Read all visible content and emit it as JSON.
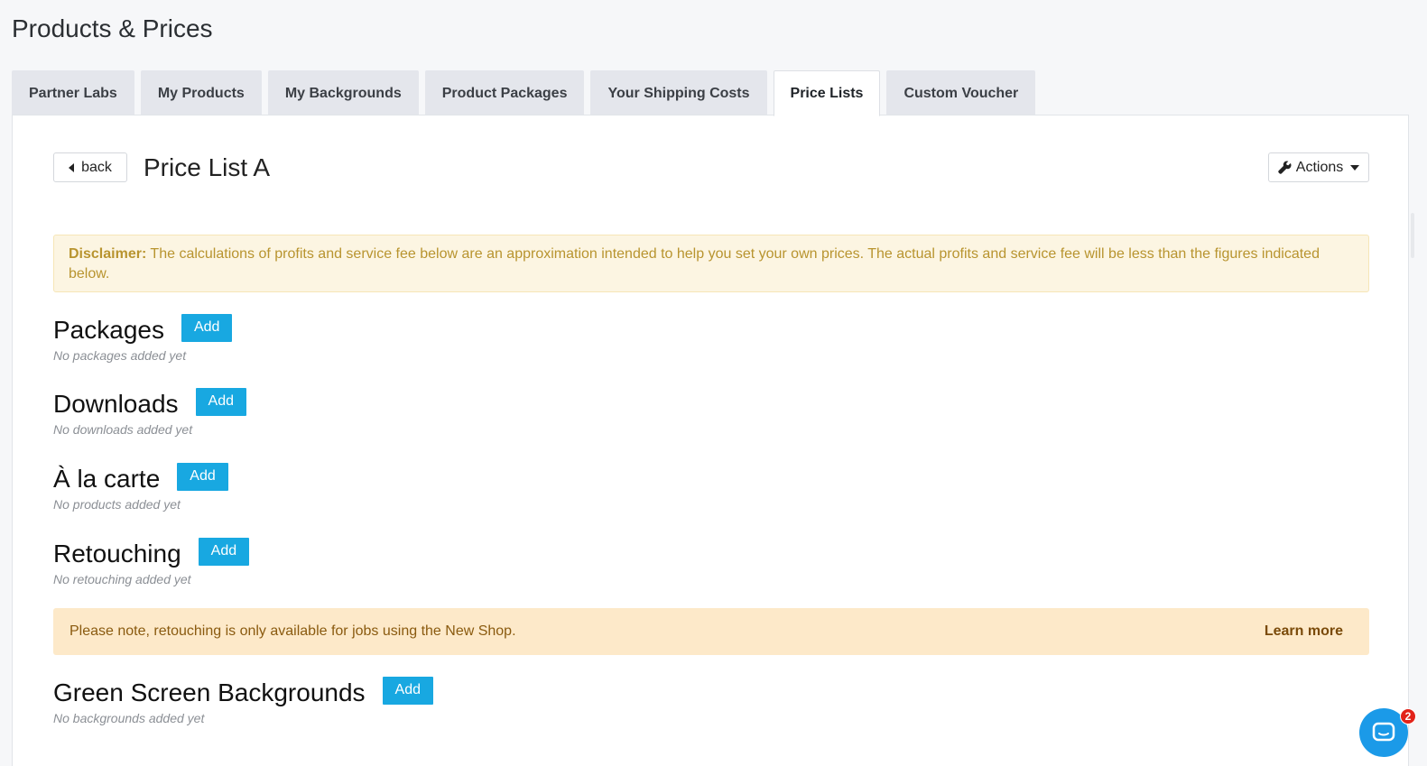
{
  "page": {
    "title": "Products & Prices"
  },
  "tabs": [
    {
      "label": "Partner Labs",
      "active": false
    },
    {
      "label": "My Products",
      "active": false
    },
    {
      "label": "My Backgrounds",
      "active": false
    },
    {
      "label": "Product Packages",
      "active": false
    },
    {
      "label": "Your Shipping Costs",
      "active": false
    },
    {
      "label": "Price Lists",
      "active": true
    },
    {
      "label": "Custom Voucher",
      "active": false
    }
  ],
  "header": {
    "back_label": "back",
    "list_title": "Price List A",
    "actions_label": "Actions"
  },
  "disclaimer": {
    "label": "Disclaimer:",
    "text": " The calculations of profits and service fee below are an approximation intended to help you set your own prices. The actual profits and service fee will be less than the figures indicated below."
  },
  "sections": {
    "packages": {
      "title": "Packages",
      "add_label": "Add",
      "empty": "No packages added yet"
    },
    "downloads": {
      "title": "Downloads",
      "add_label": "Add",
      "empty": "No downloads added yet"
    },
    "alacarte": {
      "title": "À la carte",
      "add_label": "Add",
      "empty": "No products added yet"
    },
    "retouching": {
      "title": "Retouching",
      "add_label": "Add",
      "empty": "No retouching added yet"
    },
    "backgrounds": {
      "title": "Green Screen Backgrounds",
      "add_label": "Add",
      "empty": "No backgrounds added yet"
    }
  },
  "retouch_note": {
    "text": "Please note, retouching is only available for jobs using the New Shop.",
    "link": "Learn more"
  },
  "chat": {
    "badge_count": "2"
  },
  "colors": {
    "accent": "#18a8e1",
    "warning_bg": "#fcf5e2",
    "note_bg": "#fde9c9",
    "badge": "#e2231a"
  },
  "icons": [
    "caret-left-icon",
    "wrench-icon",
    "caret-down-icon",
    "chat-icon"
  ]
}
